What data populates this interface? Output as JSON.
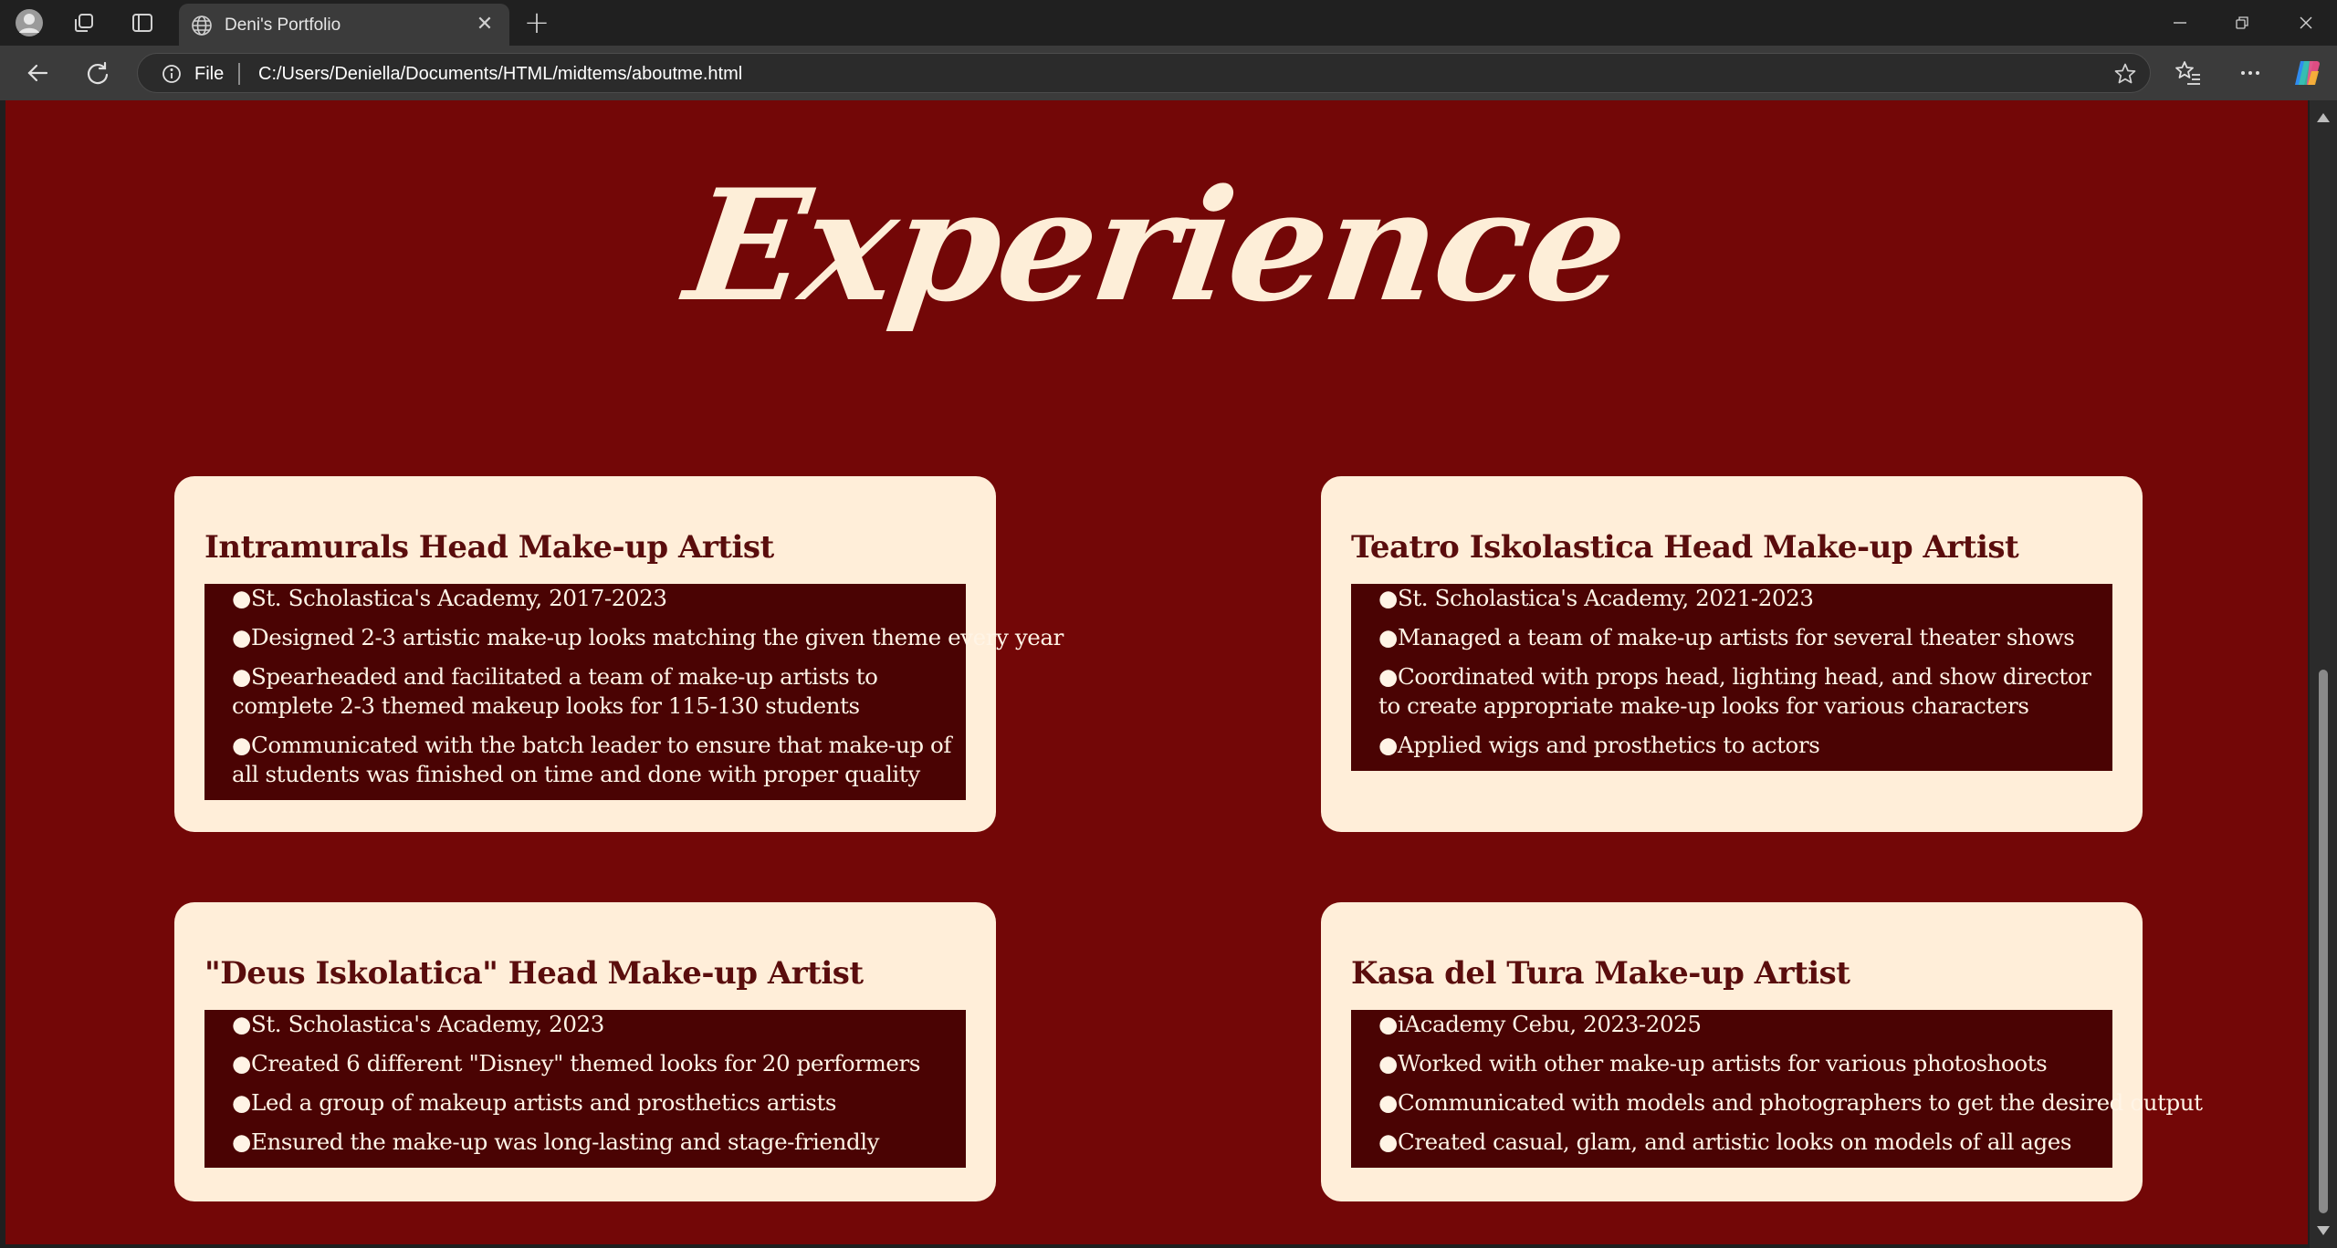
{
  "browser": {
    "tab_title": "Deni's Portfolio",
    "url_scheme_label": "File",
    "url": "C:/Users/Deniella/Documents/HTML/midtems/aboutme.html",
    "new_tab_glyph": "+",
    "close_glyph": "✕",
    "icons": [
      "profile-icon",
      "workspaces-icon",
      "tab-actions-icon",
      "globe-icon",
      "back-icon",
      "refresh-icon",
      "info-icon",
      "favorite-star-icon",
      "favorites-icon",
      "more-icon",
      "copilot-icon",
      "minimize-icon",
      "restore-icon",
      "window-close-icon"
    ]
  },
  "page": {
    "heading": "Experience",
    "colors": {
      "background": "#730707",
      "card": "#ffeed9",
      "card_box": "#4a0303",
      "title": "#5a0d0d",
      "text": "#fff4e6"
    },
    "cards": [
      {
        "title": "Intramurals Head Make-up Artist",
        "items": [
          "●St. Scholastica's Academy, 2017-2023",
          "●Designed 2-3 artistic make-up looks matching the given theme every year",
          "●Spearheaded and facilitated a team of make-up artists to complete 2-3 themed makeup looks for 115-130 students",
          "●Communicated with the batch leader to ensure that make-up of all students was finished on time and done with proper quality"
        ]
      },
      {
        "title": "Teatro Iskolastica Head Make-up Artist",
        "items": [
          "●St. Scholastica's Academy, 2021-2023",
          "●Managed a team of make-up artists for several theater shows",
          "●Coordinated with props head, lighting head, and show director to create appropriate make-up looks for various characters",
          "●Applied wigs and prosthetics to actors"
        ]
      },
      {
        "title": "\"Deus Iskolatica\" Head Make-up Artist",
        "items": [
          "●St. Scholastica's Academy, 2023",
          "●Created 6 different \"Disney\" themed looks for 20 performers",
          "●Led a group of makeup artists and prosthetics artists",
          "●Ensured the make-up was long-lasting and stage-friendly"
        ]
      },
      {
        "title": "Kasa del Tura Make-up Artist",
        "items": [
          "●iAcademy Cebu, 2023-2025",
          "●Worked with other make-up artists for various photoshoots",
          "●Communicated with models and photographers to get the desired output",
          "●Created casual, glam, and artistic looks on models of all ages"
        ]
      }
    ]
  }
}
